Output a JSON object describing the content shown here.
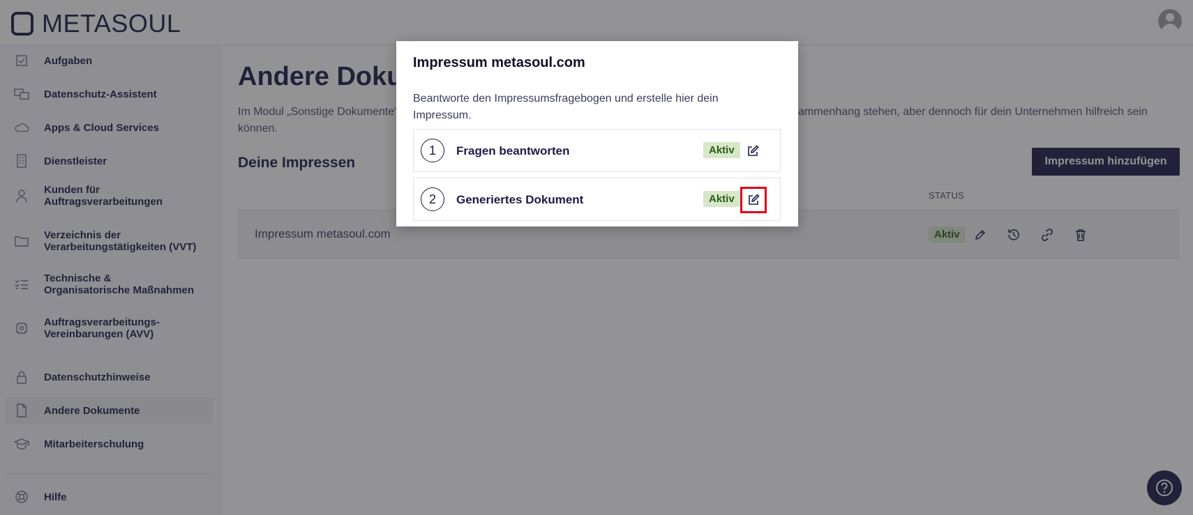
{
  "header": {
    "logo_text": "METASOUL"
  },
  "sidebar": {
    "items": [
      {
        "label": "Aufgaben",
        "icon": "checkbox-icon"
      },
      {
        "label": "Datenschutz-Assistent",
        "icon": "assistant-icon"
      },
      {
        "label": "Apps & Cloud Services",
        "icon": "cloud-icon"
      },
      {
        "label": "Dienstleister",
        "icon": "building-icon"
      },
      {
        "label": "Kunden für Auftragsverarbeitungen",
        "icon": "person-icon"
      },
      {
        "label": "Verzeichnis der Verarbeitungstätigkeiten (VVT)",
        "icon": "folder-icon"
      },
      {
        "label": "Technische & Organisatorische Maßnahmen",
        "icon": "checklist-icon"
      },
      {
        "label": "Auftragsverarbeitungs-Vereinbarungen (AVV)",
        "icon": "contract-icon"
      },
      {
        "label": "Datenschutzhinweise",
        "icon": "lock-icon"
      },
      {
        "label": "Andere Dokumente",
        "icon": "document-icon",
        "active": true
      },
      {
        "label": "Mitarbeiterschulung",
        "icon": "graduation-cap-icon"
      }
    ],
    "help_label": "Hilfe"
  },
  "main": {
    "title": "Andere Dokumente",
    "description": "Im Modul „Sonstige Dokumente“ findest du Dokumente und Vorlagen, die nicht direkt mit dem Datenschutz in Zusammenhang stehen, aber dennoch für dein Unternehmen hilfreich sein können.",
    "section_title": "Deine Impressen",
    "add_button_label": "Impressum hinzufügen",
    "table": {
      "status_header": "STATUS",
      "rows": [
        {
          "name": "Impressum metasoul.com",
          "status": "Aktiv"
        }
      ]
    }
  },
  "modal": {
    "title": "Impressum metasoul.com",
    "description": "Beantworte den Impressumsfragebogen und erstelle hier dein Impressum.",
    "steps": [
      {
        "number": "1",
        "label": "Fragen beantworten",
        "status": "Aktiv"
      },
      {
        "number": "2",
        "label": "Generiertes Dokument",
        "status": "Aktiv"
      }
    ]
  },
  "colors": {
    "brand_navy": "#1b1d47",
    "badge_green_bg": "#d6e8c8",
    "badge_green_text": "#2e5a1e",
    "highlight_red": "#e0001b"
  }
}
